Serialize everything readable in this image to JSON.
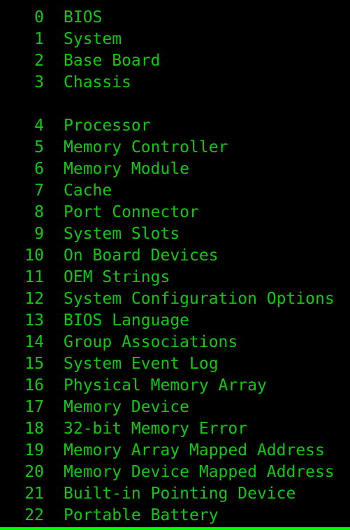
{
  "terminal": {
    "background_color": "#000000",
    "text_color": "#12c812",
    "border_color": "#00ff00",
    "rows": [
      {
        "index": "0",
        "label": "BIOS"
      },
      {
        "index": "1",
        "label": "System"
      },
      {
        "index": "2",
        "label": "Base Board"
      },
      {
        "index": "3",
        "label": "Chassis"
      },
      {
        "index": "",
        "label": ""
      },
      {
        "index": "4",
        "label": "Processor"
      },
      {
        "index": "5",
        "label": "Memory Controller"
      },
      {
        "index": "6",
        "label": "Memory Module"
      },
      {
        "index": "7",
        "label": "Cache"
      },
      {
        "index": "8",
        "label": "Port Connector"
      },
      {
        "index": "9",
        "label": "System Slots"
      },
      {
        "index": "10",
        "label": "On Board Devices"
      },
      {
        "index": "11",
        "label": "OEM Strings"
      },
      {
        "index": "12",
        "label": "System Configuration Options"
      },
      {
        "index": "13",
        "label": "BIOS Language"
      },
      {
        "index": "14",
        "label": "Group Associations"
      },
      {
        "index": "15",
        "label": "System Event Log"
      },
      {
        "index": "16",
        "label": "Physical Memory Array"
      },
      {
        "index": "17",
        "label": "Memory Device"
      },
      {
        "index": "18",
        "label": "32-bit Memory Error"
      },
      {
        "index": "19",
        "label": "Memory Array Mapped Address"
      },
      {
        "index": "20",
        "label": "Memory Device Mapped Address"
      },
      {
        "index": "21",
        "label": "Built-in Pointing Device"
      },
      {
        "index": "22",
        "label": "Portable Battery"
      }
    ]
  }
}
